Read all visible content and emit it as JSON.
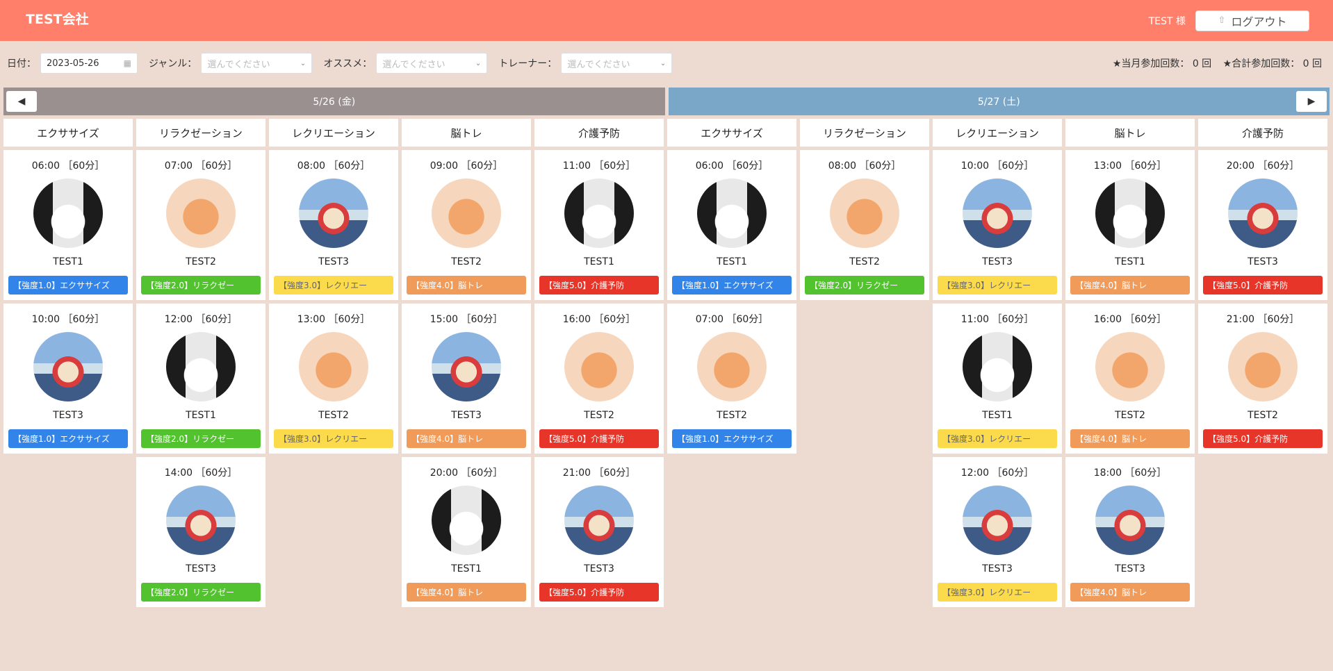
{
  "header": {
    "company": "TEST会社",
    "user": "TEST 様",
    "logout_label": "ログアウト",
    "logout_icon": "logout-icon"
  },
  "filters": {
    "date_label": "日付：",
    "date_value": "2023-05-26",
    "genre_label": "ジャンル：",
    "genre_placeholder": "選んでください",
    "recommend_label": "オススメ：",
    "recommend_placeholder": "選んでください",
    "trainer_label": "トレーナー：",
    "trainer_placeholder": "選んでください"
  },
  "counts": {
    "monthly": "★当月参加回数： 0 回",
    "total": "★合計参加回数： 0 回"
  },
  "days": {
    "left": "5/26 (金)",
    "right": "5/27 (土)",
    "prev": "◀",
    "next": "▶"
  },
  "columns": [
    {
      "genre": "エクササイズ",
      "cards": [
        {
          "time": "06:00 ［60分］",
          "trainer": "TEST1",
          "avatar": "panda",
          "badge": "【強度1.0】エクササイズ",
          "level": 1
        },
        {
          "time": "10:00 ［60分］",
          "trainer": "TEST3",
          "avatar": "bunny",
          "badge": "【強度1.0】エクササイズ",
          "level": 1
        }
      ]
    },
    {
      "genre": "リラクゼーション",
      "cards": [
        {
          "time": "07:00 ［60分］",
          "trainer": "TEST2",
          "avatar": "dog",
          "badge": "【強度2.0】リラクゼー",
          "level": 2
        },
        {
          "time": "12:00 ［60分］",
          "trainer": "TEST1",
          "avatar": "panda",
          "badge": "【強度2.0】リラクゼー",
          "level": 2
        },
        {
          "time": "14:00 ［60分］",
          "trainer": "TEST3",
          "avatar": "bunny",
          "badge": "【強度2.0】リラクゼー",
          "level": 2
        }
      ]
    },
    {
      "genre": "レクリエーション",
      "cards": [
        {
          "time": "08:00 ［60分］",
          "trainer": "TEST3",
          "avatar": "bunny",
          "badge": "【強度3.0】レクリエー",
          "level": 3
        },
        {
          "time": "13:00 ［60分］",
          "trainer": "TEST2",
          "avatar": "dog",
          "badge": "【強度3.0】レクリエー",
          "level": 3
        }
      ]
    },
    {
      "genre": "脳トレ",
      "cards": [
        {
          "time": "09:00 ［60分］",
          "trainer": "TEST2",
          "avatar": "dog",
          "badge": "【強度4.0】脳トレ",
          "level": 4
        },
        {
          "time": "15:00 ［60分］",
          "trainer": "TEST3",
          "avatar": "bunny",
          "badge": "【強度4.0】脳トレ",
          "level": 4
        },
        {
          "time": "20:00 ［60分］",
          "trainer": "TEST1",
          "avatar": "panda",
          "badge": "【強度4.0】脳トレ",
          "level": 4
        }
      ]
    },
    {
      "genre": "介護予防",
      "cards": [
        {
          "time": "11:00 ［60分］",
          "trainer": "TEST1",
          "avatar": "panda",
          "badge": "【強度5.0】介護予防",
          "level": 5
        },
        {
          "time": "16:00 ［60分］",
          "trainer": "TEST2",
          "avatar": "dog",
          "badge": "【強度5.0】介護予防",
          "level": 5
        },
        {
          "time": "21:00 ［60分］",
          "trainer": "TEST3",
          "avatar": "bunny",
          "badge": "【強度5.0】介護予防",
          "level": 5
        }
      ]
    },
    {
      "genre": "エクササイズ",
      "cards": [
        {
          "time": "06:00 ［60分］",
          "trainer": "TEST1",
          "avatar": "panda",
          "badge": "【強度1.0】エクササイズ",
          "level": 1
        },
        {
          "time": "07:00 ［60分］",
          "trainer": "TEST2",
          "avatar": "dog",
          "badge": "【強度1.0】エクササイズ",
          "level": 1
        }
      ]
    },
    {
      "genre": "リラクゼーション",
      "cards": [
        {
          "time": "08:00 ［60分］",
          "trainer": "TEST2",
          "avatar": "dog",
          "badge": "【強度2.0】リラクゼー",
          "level": 2
        }
      ]
    },
    {
      "genre": "レクリエーション",
      "cards": [
        {
          "time": "10:00 ［60分］",
          "trainer": "TEST3",
          "avatar": "bunny",
          "badge": "【強度3.0】レクリエー",
          "level": 3
        },
        {
          "time": "11:00 ［60分］",
          "trainer": "TEST1",
          "avatar": "panda",
          "badge": "【強度3.0】レクリエー",
          "level": 3
        },
        {
          "time": "12:00 ［60分］",
          "trainer": "TEST3",
          "avatar": "bunny",
          "badge": "【強度3.0】レクリエー",
          "level": 3
        }
      ]
    },
    {
      "genre": "脳トレ",
      "cards": [
        {
          "time": "13:00 ［60分］",
          "trainer": "TEST1",
          "avatar": "panda",
          "badge": "【強度4.0】脳トレ",
          "level": 4
        },
        {
          "time": "16:00 ［60分］",
          "trainer": "TEST2",
          "avatar": "dog",
          "badge": "【強度4.0】脳トレ",
          "level": 4
        },
        {
          "time": "18:00 ［60分］",
          "trainer": "TEST3",
          "avatar": "bunny",
          "badge": "【強度4.0】脳トレ",
          "level": 4
        }
      ]
    },
    {
      "genre": "介護予防",
      "cards": [
        {
          "time": "20:00 ［60分］",
          "trainer": "TEST3",
          "avatar": "bunny",
          "badge": "【強度5.0】介護予防",
          "level": 5
        },
        {
          "time": "21:00 ［60分］",
          "trainer": "TEST2",
          "avatar": "dog",
          "badge": "【強度5.0】介護予防",
          "level": 5
        }
      ]
    }
  ],
  "colors": {
    "header": "#ff7f6a",
    "background": "#eddbd2",
    "day_left": "#9b9090",
    "day_right": "#7aa6c8",
    "level1": "#3384e8",
    "level2": "#52c22f",
    "level3": "#fbdb4c",
    "level4": "#f09b5a",
    "level5": "#e83529"
  }
}
